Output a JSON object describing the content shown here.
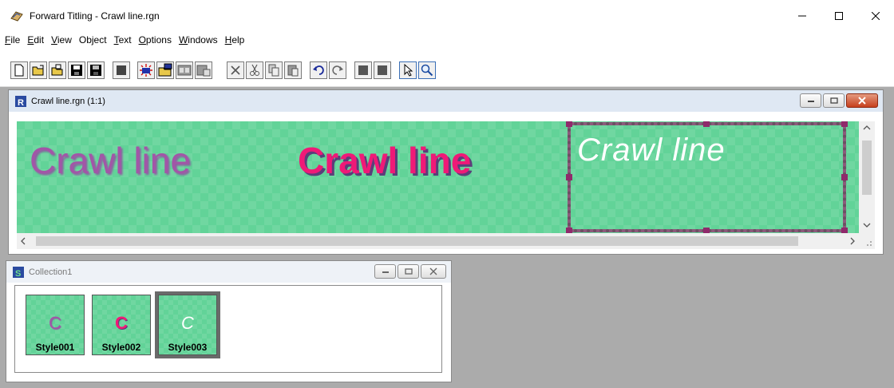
{
  "app": {
    "title": "Forward Titling - Crawl line.rgn"
  },
  "menu": {
    "items": [
      {
        "mnemonic": "F",
        "rest": "ile"
      },
      {
        "mnemonic": "E",
        "rest": "dit"
      },
      {
        "mnemonic": "V",
        "rest": "iew"
      },
      {
        "mnemonic": "",
        "rest": "Object"
      },
      {
        "mnemonic": "T",
        "rest": "ext"
      },
      {
        "mnemonic": "O",
        "rest": "ptions"
      },
      {
        "mnemonic": "W",
        "rest": "indows"
      },
      {
        "mnemonic": "H",
        "rest": "elp"
      }
    ]
  },
  "toolbar": {
    "buttons": [
      "new-file-icon",
      "open-file-icon",
      "open-folder-icon",
      "save-icon",
      "save-all-icon",
      "stop-icon",
      "effect-icon",
      "import-image-icon",
      "film-strip-icon",
      "film-edit-icon",
      "delete-icon",
      "cut-icon",
      "copy-icon",
      "paste-icon",
      "undo-icon",
      "redo-icon",
      "block-a-icon",
      "block-b-icon",
      "pointer-icon",
      "zoom-icon"
    ]
  },
  "document": {
    "title": "Crawl line.rgn  (1:1)",
    "texts": [
      "Crawl line",
      "Crawl line",
      "Crawl line"
    ],
    "colors": {
      "background": "#62d398",
      "style1": "#a256a7",
      "style2": "#ef1a77",
      "style3": "#ffffff"
    }
  },
  "collection": {
    "title": "Collection1",
    "styles": [
      {
        "glyph": "C",
        "label": "Style001"
      },
      {
        "glyph": "C",
        "label": "Style002"
      },
      {
        "glyph": "C",
        "label": "Style003"
      }
    ]
  }
}
